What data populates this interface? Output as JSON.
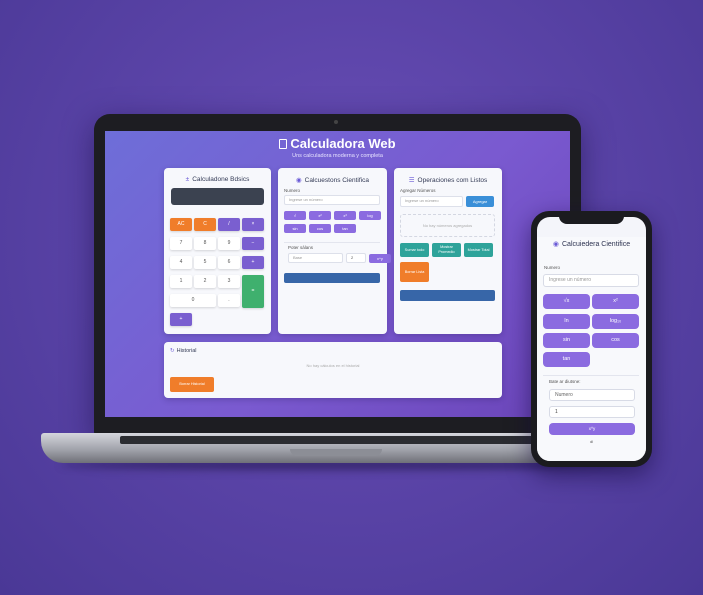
{
  "laptop": {
    "app_title": "Calculadora Web",
    "app_subtitle": "Uns calculadora moderna y completa",
    "basic": {
      "title": "Calculadone Bdsics",
      "keys": [
        "AC",
        "C",
        "/",
        "×",
        "7",
        "8",
        "9",
        "−",
        "4",
        "5",
        "6",
        "+",
        "1",
        "2",
        "3",
        "=",
        "0",
        ".",
        "+"
      ]
    },
    "scientific": {
      "title": "Calcuestons Cientifica",
      "number_label": "Numero",
      "number_placeholder": "Ingrese un número",
      "functions": [
        "√",
        "x²",
        "x³",
        "log",
        "sin",
        "cos",
        "tan"
      ],
      "power_label": "Poter sálans",
      "base_placeholder": "Base",
      "exp_value": "2",
      "power_button": "x^y"
    },
    "lists": {
      "title": "Operaciones com Listos",
      "add_label": "Agregar Números",
      "add_placeholder": "Ingrese un número",
      "add_button": "Agregar",
      "empty_text": "No hay números agregados",
      "ops": [
        "Sumar todo",
        "Mostrar Promedio",
        "Mostrar Total"
      ],
      "clear_button": "Borrar Lista"
    },
    "history": {
      "title": "Historial",
      "empty_text": "No hay cálculos en el historial",
      "clear_button": "Borrar Historial"
    }
  },
  "phone": {
    "title": "Calcuiedera Cientifice",
    "number_label": "Numero",
    "number_placeholder": "Ingrese un número",
    "keys": [
      "√x",
      "x²",
      "ln",
      "log₁₀",
      "sin",
      "cos",
      "tan"
    ],
    "power_label": "Bate ar diutsne:",
    "base_placeholder": "Numero",
    "exp_value": "1",
    "calc_button": "x^y",
    "footer": "dl"
  }
}
